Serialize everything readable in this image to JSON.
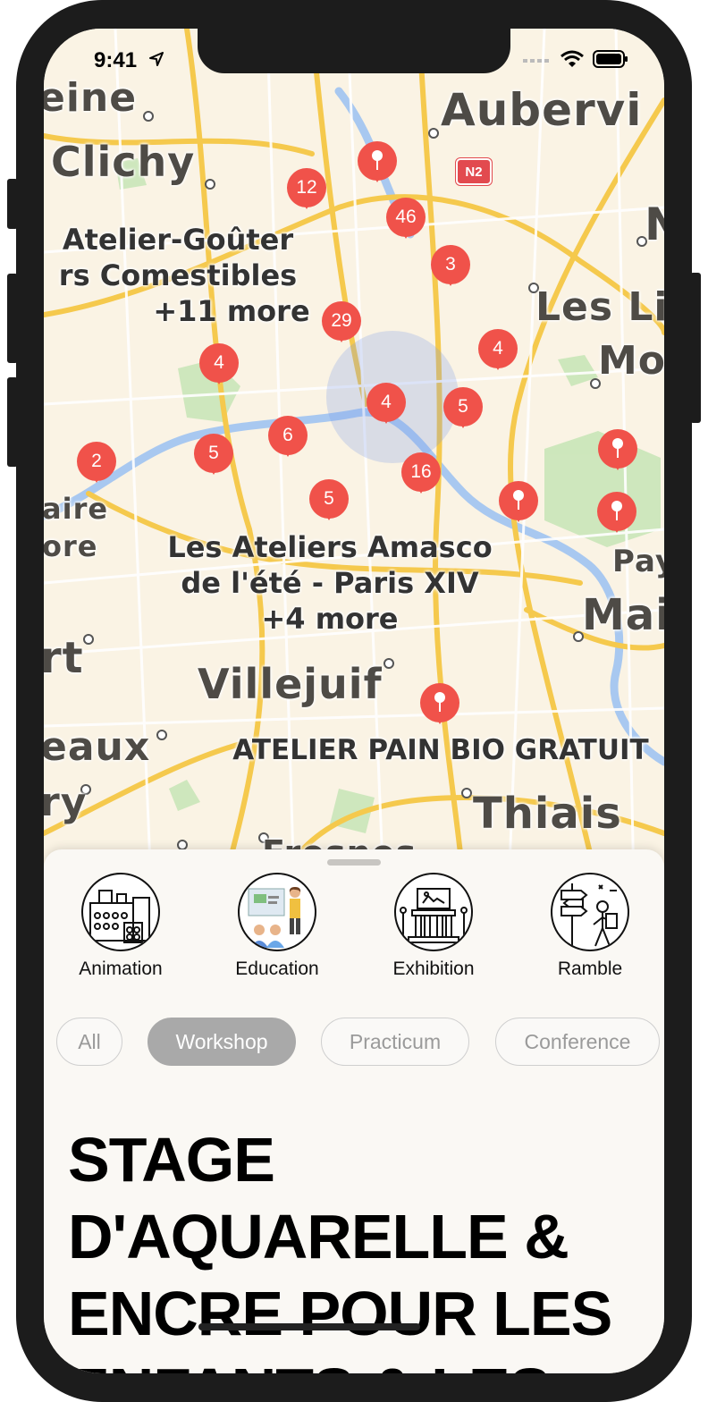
{
  "status_bar": {
    "time": "9:41"
  },
  "map": {
    "places": [
      {
        "name": "eine"
      },
      {
        "name": "Aubervi"
      },
      {
        "name": "Clichy"
      },
      {
        "name": "N"
      },
      {
        "name": "Les Li"
      },
      {
        "name": "Mo"
      },
      {
        "name": "aire"
      },
      {
        "name": "ore"
      },
      {
        "name": "Pay"
      },
      {
        "name": "Mai"
      },
      {
        "name": "rt"
      },
      {
        "name": "Villejuif"
      },
      {
        "name": "eaux"
      },
      {
        "name": "ry"
      },
      {
        "name": "Thiais"
      },
      {
        "name": "Fresnes"
      }
    ],
    "road_badge": "N2",
    "poi_labels": [
      {
        "line1": "Atelier-Goûter",
        "line2": "rs Comestibles",
        "more": "+11 more"
      },
      {
        "line1": "Les Ateliers Amasco",
        "line2": "de l'été - Paris XIV",
        "more": "+4 more"
      },
      {
        "line1": "ATELIER PAIN BIO GRATUIT"
      }
    ],
    "clusters": [
      "12",
      "46",
      "3",
      "29",
      "4",
      "4",
      "4",
      "5",
      "2",
      "5",
      "6",
      "16",
      "5"
    ]
  },
  "categories": [
    {
      "label": "Animation",
      "icon": "factory-icon"
    },
    {
      "label": "Education",
      "icon": "teacher-icon"
    },
    {
      "label": "Exhibition",
      "icon": "museum-icon"
    },
    {
      "label": "Ramble",
      "icon": "signpost-hiker-icon"
    }
  ],
  "filters": [
    {
      "label": "All",
      "active": false
    },
    {
      "label": "Workshop",
      "active": true
    },
    {
      "label": "Practicum",
      "active": false
    },
    {
      "label": "Conference",
      "active": false
    }
  ],
  "event": {
    "title": "STAGE D'AQUARELLE & ENCRE POUR LES ENFANTS & LES"
  },
  "colors": {
    "pin": "#f0524a",
    "user_location": "#2f74f5",
    "chip_active": "#a9a9a9"
  }
}
